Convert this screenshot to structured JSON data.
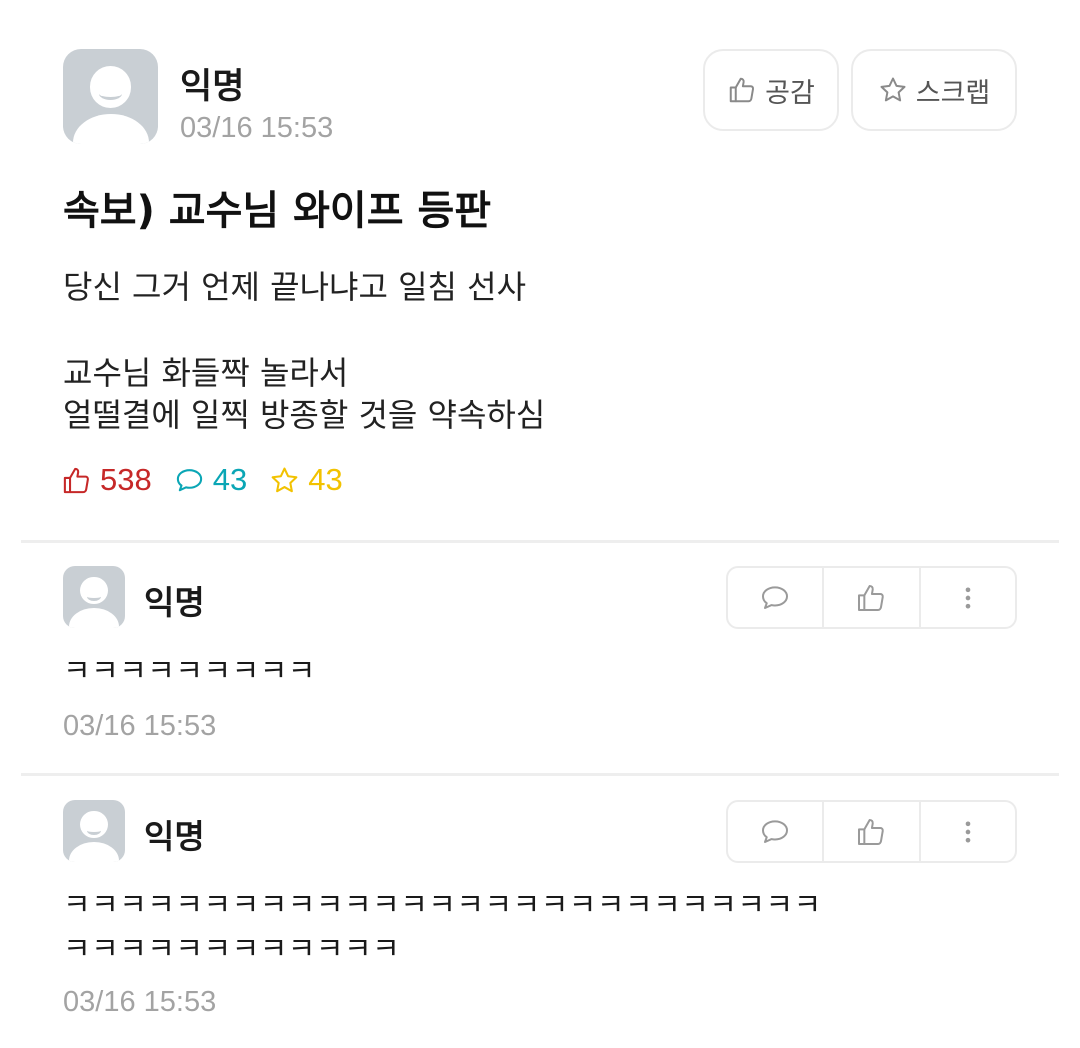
{
  "post": {
    "author": "익명",
    "date": "03/16 15:53",
    "like_button": "공감",
    "scrap_button": "스크랩",
    "title": "속보) 교수님 와이프 등판",
    "body": [
      "당신 그거 언제 끝나냐고 일침 선사",
      "교수님 화들짝 놀라서",
      "얼떨결에 일찍 방종할 것을 약속하심"
    ],
    "stats": {
      "likes": "538",
      "comments": "43",
      "scraps": "43"
    }
  },
  "colors": {
    "likes": "#c62828",
    "comments": "#0aa6b5",
    "scraps": "#f2c200"
  },
  "comments": [
    {
      "author": "익명",
      "lines": [
        "ㅋㅋㅋㅋㅋㅋㅋㅋㅋ"
      ],
      "date": "03/16 15:53"
    },
    {
      "author": "익명",
      "lines": [
        "ㅋㅋㅋㅋㅋㅋㅋㅋㅋㅋㅋㅋㅋㅋㅋㅋㅋㅋㅋㅋㅋㅋㅋㅋㅋㅋㅋ",
        "ㅋㅋㅋㅋㅋㅋㅋㅋㅋㅋㅋㅋ"
      ],
      "date": "03/16 15:53"
    }
  ],
  "icons": {
    "like": "thumbs-up-icon",
    "star": "star-icon",
    "comment": "speech-bubble-icon",
    "more": "more-vertical-icon"
  }
}
